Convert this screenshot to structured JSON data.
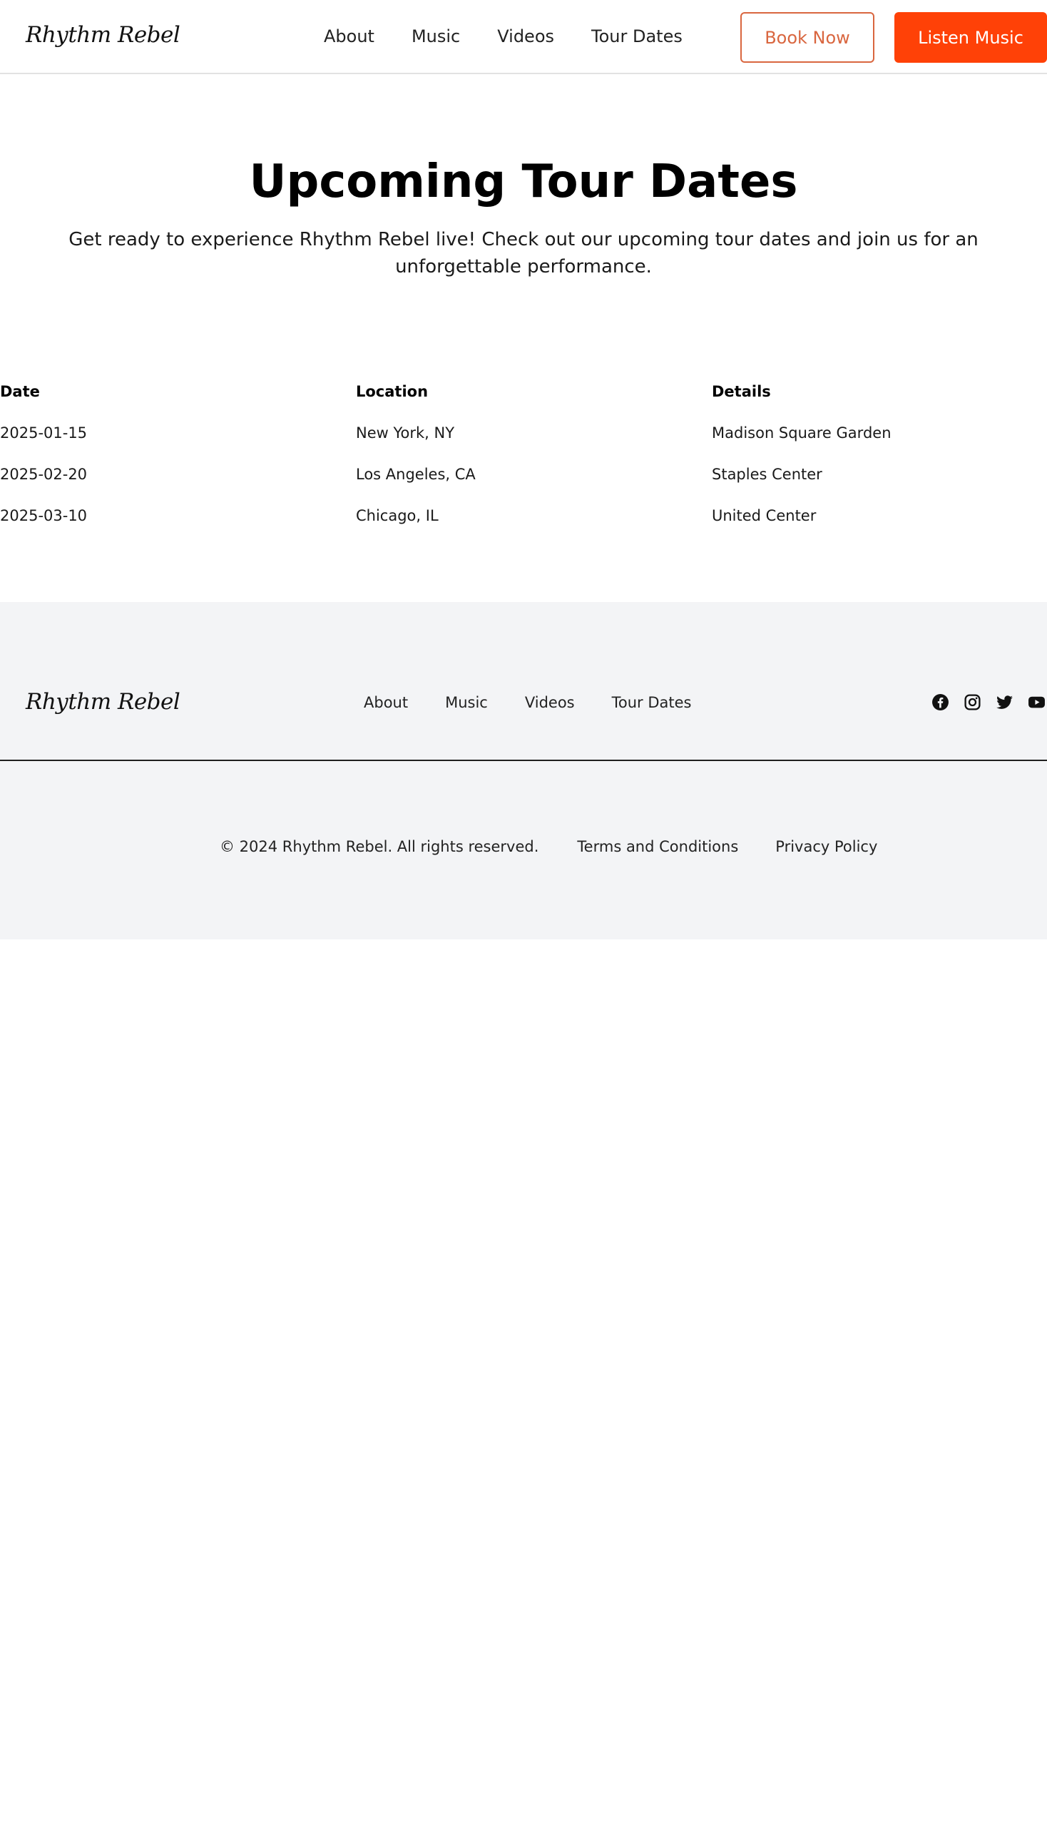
{
  "header": {
    "logo": "Rhythm Rebel",
    "nav": [
      "About",
      "Music",
      "Videos",
      "Tour Dates"
    ],
    "book_button": "Book Now",
    "listen_button": "Listen Music",
    "colors": {
      "accent": "#ff4107",
      "outline": "#d9663f"
    }
  },
  "hero": {
    "title": "Upcoming Tour Dates",
    "subtitle": "Get ready to experience Rhythm Rebel live! Check out our upcoming tour dates and join us for an unforgettable performance."
  },
  "tour_table": {
    "headers": [
      "Date",
      "Location",
      "Details"
    ],
    "rows": [
      [
        "2025-01-15",
        "New York, NY",
        "Madison Square Garden"
      ],
      [
        "2025-02-20",
        "Los Angeles, CA",
        "Staples Center"
      ],
      [
        "2025-03-10",
        "Chicago, IL",
        "United Center"
      ]
    ]
  },
  "footer": {
    "logo": "Rhythm Rebel",
    "nav": [
      "About",
      "Music",
      "Videos",
      "Tour Dates"
    ],
    "social_icons": [
      "facebook-icon",
      "instagram-icon",
      "twitter-icon",
      "youtube-icon"
    ],
    "copyright": "© 2024 Rhythm Rebel. All rights reserved.",
    "terms": "Terms and Conditions",
    "privacy": "Privacy Policy",
    "background": "#f3f4f6"
  }
}
